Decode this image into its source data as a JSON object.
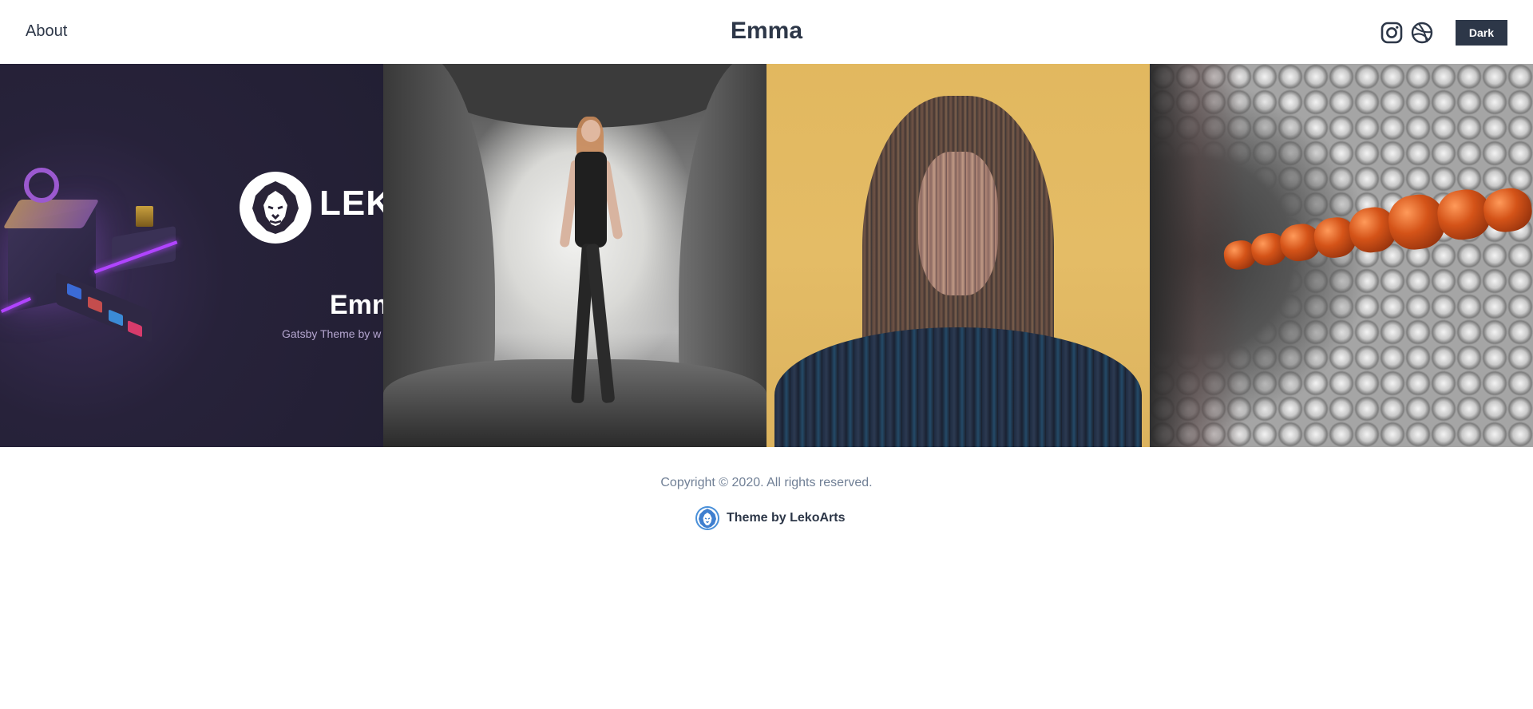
{
  "header": {
    "nav": [
      {
        "label": "About"
      }
    ],
    "site_title": "Emma",
    "social": [
      {
        "icon": "instagram-icon"
      },
      {
        "icon": "dribbble-icon"
      }
    ],
    "mode_button_label": "Dark"
  },
  "gallery": {
    "items": [
      {
        "kind": "project-image",
        "brand_text": "LEK",
        "title_text": "Emm",
        "subtitle_text": "Gatsby Theme by w"
      },
      {
        "kind": "project-image"
      },
      {
        "kind": "project-image"
      },
      {
        "kind": "project-image"
      }
    ]
  },
  "footer": {
    "copyright": "Copyright © 2020. All rights reserved.",
    "theme_credit": "Theme by LekoArts",
    "theme_credit_icon": "lekoarts-lion-icon"
  },
  "colors": {
    "text_primary": "#2d3748",
    "text_muted": "#718096",
    "button_bg": "#2d3748",
    "promo_bg": "#221f33",
    "accent_purple": "#b044ff",
    "portrait_yellow": "#e2b85f"
  }
}
